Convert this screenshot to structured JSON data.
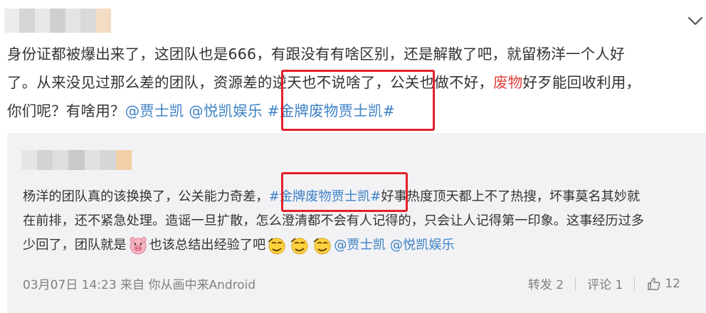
{
  "post": {
    "lines": [
      [
        "身份证都被爆出来了，这团队也是666，有跟没有有啥区别，还是解散了吧，就留杨洋一个人好"
      ],
      [
        "了。从来没见过那么差的团队，资源差的逆天也不说啥了，公关也做不好，",
        "废物",
        "好歹能回收利用，"
      ],
      [
        "你们呢？有啥用？",
        "@贾士凯",
        "@悦凯娱乐",
        "#金牌废物贾士凯#"
      ]
    ]
  },
  "repost": {
    "lines": [
      [
        "杨洋的团队真的该换换了，公关能力奇差，",
        "#金牌废物贾士凯#",
        "好事热度顶天都上不了热搜，坏事莫名其妙就"
      ],
      [
        "在前排，还不紧急处理。造谣一旦扩散，怎么澄清都不会有人记得的，只会让人记得第一印象。这事经历过多"
      ],
      [
        "少回了，团队就是",
        "也该总结出经验了吧",
        "@贾士凯",
        "@悦凯娱乐"
      ]
    ],
    "meta": "03月07日 14:23 来自 你从画中来Android",
    "forward_label": "转发 2",
    "comment_label": "评论 1",
    "like_count": "12"
  },
  "icons": {
    "chevron": "chevron-down-icon",
    "pig": "pig-emoji-icon",
    "smug": "smug-emoji-icon",
    "like": "thumbs-up-icon"
  },
  "colors": {
    "mention": "#3d82c6",
    "highlight": "#e3403f",
    "annotation": "#e3202a",
    "card_bg": "#f2f2f5"
  }
}
